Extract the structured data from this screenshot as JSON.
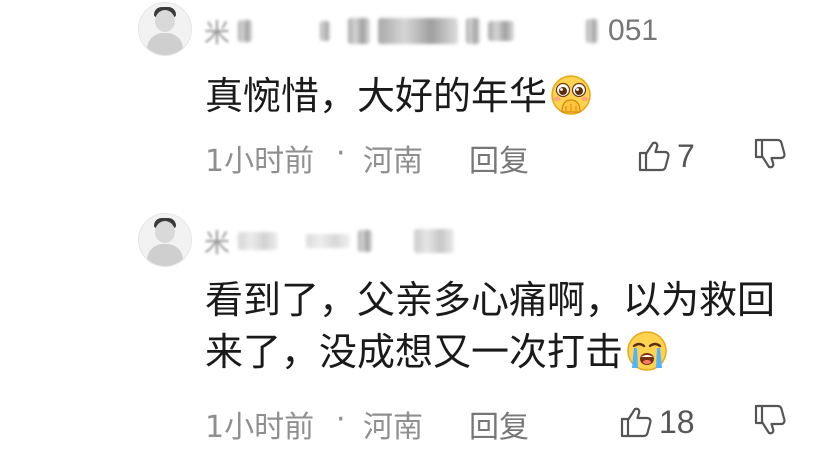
{
  "comments": [
    {
      "username_suffix": "051",
      "text": "真惋惜，大好的年华",
      "emoji": "hand-over-mouth-face-icon",
      "time": "1小时前",
      "separator": "·",
      "location": "河南",
      "reply_label": "回复",
      "likes": "7"
    },
    {
      "text_line1": "看到了，父亲多心痛啊，以为救回",
      "text_line2": "来了，没成想又一次打击",
      "emoji": "crying-face-icon",
      "time": "1小时前",
      "separator": "·",
      "location": "河南",
      "reply_label": "回复",
      "likes": "18"
    }
  ],
  "colors": {
    "text": "#1a1a1a",
    "meta": "#8f8f8f",
    "icon": "#555555"
  }
}
